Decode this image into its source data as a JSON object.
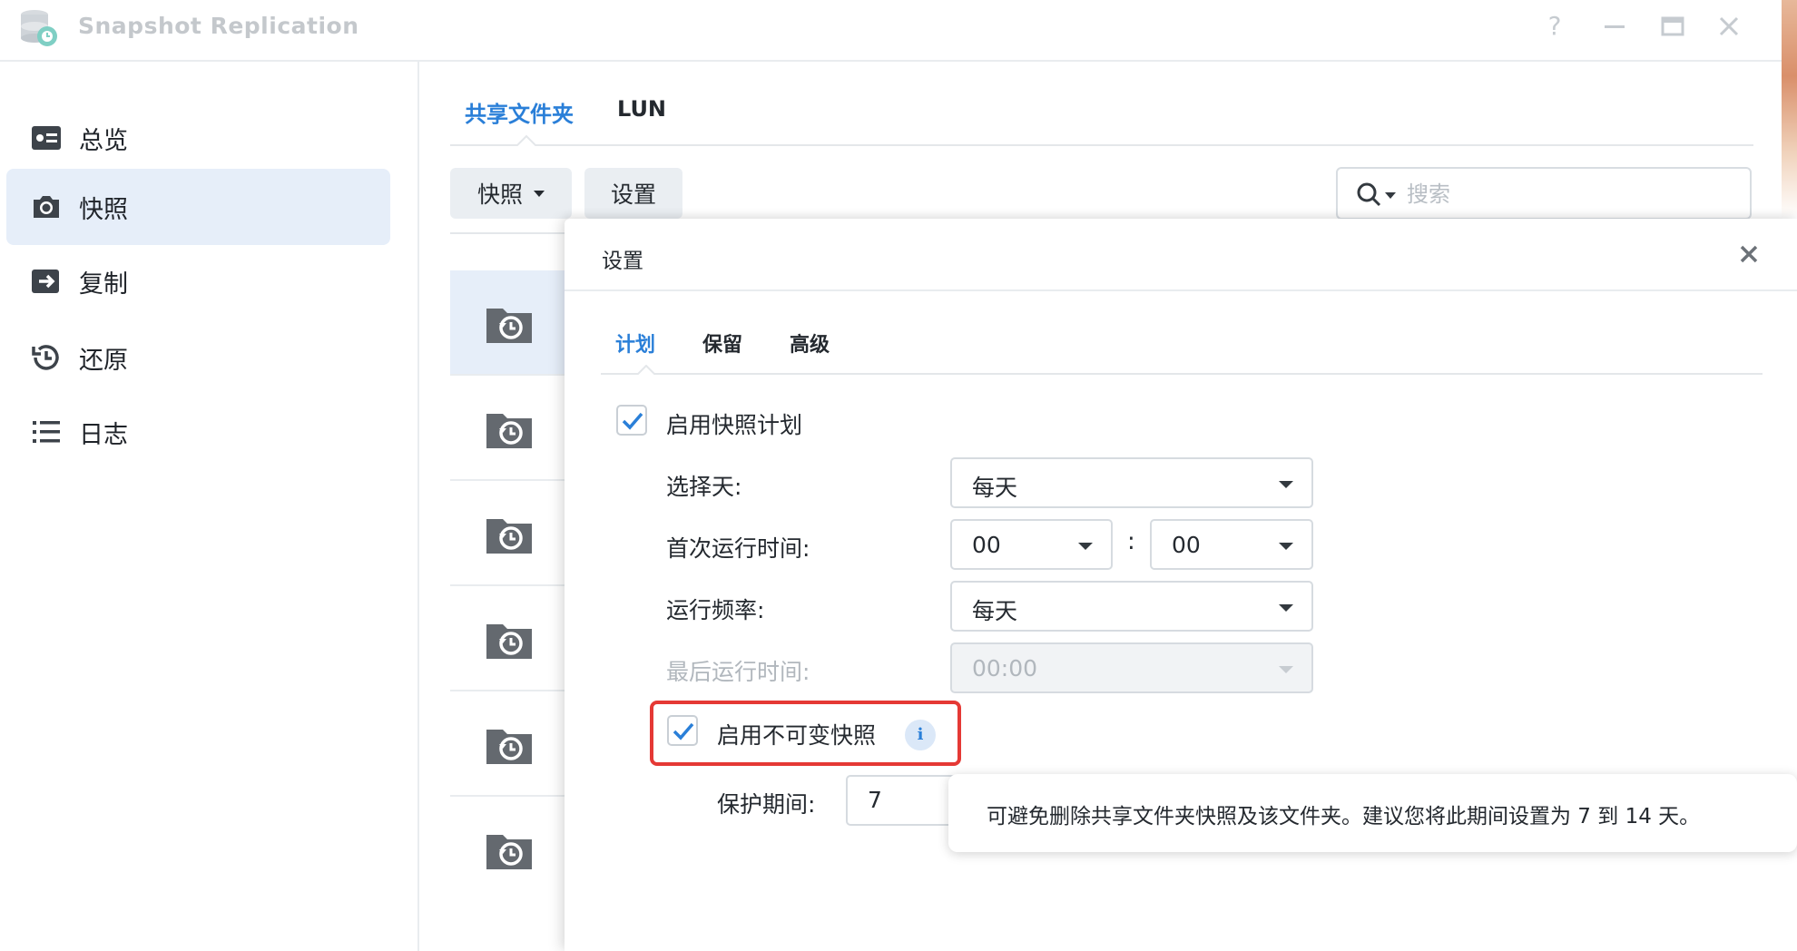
{
  "window": {
    "app_title": "Snapshot Replication",
    "controls": {
      "help": "?"
    }
  },
  "sidebar": {
    "items": [
      {
        "label": "总览",
        "icon": "overview-icon"
      },
      {
        "label": "快照",
        "icon": "camera-icon",
        "active": true
      },
      {
        "label": "复制",
        "icon": "replication-icon"
      },
      {
        "label": "还原",
        "icon": "restore-icon"
      },
      {
        "label": "日志",
        "icon": "log-list-icon"
      }
    ]
  },
  "main": {
    "tabs": [
      {
        "label": "共享文件夹",
        "active": true
      },
      {
        "label": "LUN"
      }
    ],
    "toolbar": {
      "snapshot_label": "快照",
      "settings_label": "设置"
    },
    "search": {
      "placeholder": "搜索"
    }
  },
  "settings_dialog": {
    "title": "设置",
    "tabs": [
      {
        "label": "计划",
        "active": true
      },
      {
        "label": "保留"
      },
      {
        "label": "高级"
      }
    ],
    "enable_schedule": {
      "label": "启用快照计划",
      "checked": true
    },
    "select_day": {
      "label": "选择天:",
      "value": "每天"
    },
    "first_run_time": {
      "label": "首次运行时间:",
      "hour": "00",
      "separator": ":",
      "minute": "00"
    },
    "frequency": {
      "label": "运行频率:",
      "value": "每天"
    },
    "last_run_time": {
      "label": "最后运行时间:",
      "value": "00:00",
      "disabled": true
    },
    "immutable": {
      "label": "启用不可变快照",
      "checked": true
    },
    "protection_period": {
      "label": "保护期间:",
      "value": "7"
    },
    "tooltip": "可避免删除共享文件夹快照及该文件夹。建议您将此期间设置为 7 到 14 天。"
  },
  "colors": {
    "accent": "#2a7fd8",
    "highlight_border": "#e53935",
    "active_bg": "#e6eef9"
  }
}
